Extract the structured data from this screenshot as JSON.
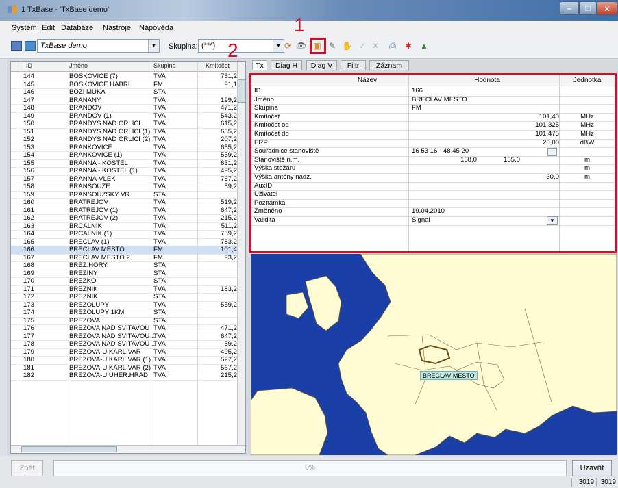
{
  "window": {
    "title": "1 TxBase - 'TxBase demo'",
    "min": "–",
    "max": "□",
    "close": "x"
  },
  "menu": [
    "Systém",
    "Edit",
    "Databáze",
    "Nástroje",
    "Nápověda"
  ],
  "toolbar": {
    "database": "TxBase demo",
    "skupina_label": "Skupina:",
    "skupina_value": "(***)"
  },
  "annotations": {
    "a1": "1",
    "a2": "2"
  },
  "grid": {
    "headers": [
      "ID",
      "Jméno",
      "Skupina",
      "Kmitočet"
    ],
    "rows": [
      [
        "144",
        "BOSKOVICE (7)",
        "TVA",
        "751,2"
      ],
      [
        "145",
        "BOSKOVICE HABRI",
        "FM",
        "91,1"
      ],
      [
        "146",
        "BOZI MUKA",
        "STA",
        ""
      ],
      [
        "147",
        "BRANANY",
        "TVA",
        "199,2"
      ],
      [
        "148",
        "BRANDOV",
        "TVA",
        "471,2"
      ],
      [
        "149",
        "BRANDOV (1)",
        "TVA",
        "543,2"
      ],
      [
        "150",
        "BRANDYS NAD ORLICI",
        "TVA",
        "615,2"
      ],
      [
        "151",
        "BRANDYS NAD ORLICI (1)",
        "TVA",
        "655,2"
      ],
      [
        "152",
        "BRANDYS NAD ORLICI (2)",
        "TVA",
        "207,2"
      ],
      [
        "153",
        "BRANKOVICE",
        "TVA",
        "655,2"
      ],
      [
        "154",
        "BRANKOVICE (1)",
        "TVA",
        "559,2"
      ],
      [
        "155",
        "BRANNA - KOSTEL",
        "TVA",
        "631,2"
      ],
      [
        "156",
        "BRANNA - KOSTEL (1)",
        "TVA",
        "495,2"
      ],
      [
        "157",
        "BRANNA-VLEK",
        "TVA",
        "767,2"
      ],
      [
        "158",
        "BRANSOUZE",
        "TVA",
        "59,2"
      ],
      [
        "159",
        "BRANSOUZSKY VR",
        "STA",
        ""
      ],
      [
        "160",
        "BRATREJOV",
        "TVA",
        "519,2"
      ],
      [
        "161",
        "BRATREJOV (1)",
        "TVA",
        "647,2"
      ],
      [
        "162",
        "BRATREJOV (2)",
        "TVA",
        "215,2"
      ],
      [
        "163",
        "BRCALNIK",
        "TVA",
        "511,2"
      ],
      [
        "164",
        "BRCALNIK (1)",
        "TVA",
        "759,2"
      ],
      [
        "165",
        "BRECLAV (1)",
        "TVA",
        "783,2"
      ],
      [
        "166",
        "BRECLAV MESTO",
        "FM",
        "101,4"
      ],
      [
        "167",
        "BRECLAV MESTO 2",
        "FM",
        "93,2"
      ],
      [
        "168",
        "BREZ.HORY",
        "STA",
        ""
      ],
      [
        "169",
        "BREZINY",
        "STA",
        ""
      ],
      [
        "170",
        "BREZKO",
        "STA",
        ""
      ],
      [
        "171",
        "BREZNIK",
        "TVA",
        "183,2"
      ],
      [
        "172",
        "BREZNIK",
        "STA",
        ""
      ],
      [
        "173",
        "BREZOLUPY",
        "TVA",
        "559,2"
      ],
      [
        "174",
        "BREZOLUPY 1KM",
        "STA",
        ""
      ],
      [
        "175",
        "BREZOVA",
        "STA",
        ""
      ],
      [
        "176",
        "BREZOVA NAD SVITAVOU",
        "TVA",
        "471,2"
      ],
      [
        "177",
        "BREZOVA NAD SVITAVOU ...",
        "TVA",
        "647,2"
      ],
      [
        "178",
        "BREZOVA NAD SVITAVOU ...",
        "TVA",
        "59,2"
      ],
      [
        "179",
        "BREZOVA-U KARL.VAR",
        "TVA",
        "495,2"
      ],
      [
        "180",
        "BREZOVA-U KARL.VAR (1)",
        "TVA",
        "527,2"
      ],
      [
        "181",
        "BREZOVA-U KARL.VAR (2)",
        "TVA",
        "567,2"
      ],
      [
        "182",
        "BREZOVA-U UHER.HRAD",
        "TVA",
        "215,2"
      ]
    ],
    "selected_id": "166"
  },
  "tabs": [
    "Tx",
    "Diag H",
    "Diag V",
    "Filtr",
    "Záznam"
  ],
  "props": {
    "headers": [
      "Název",
      "Hodnota",
      "Jednotka"
    ],
    "rows": [
      {
        "name": "ID",
        "value": "166",
        "unit": "",
        "align": "left"
      },
      {
        "name": "Jméno",
        "value": "BRECLAV MESTO",
        "unit": "",
        "align": "left"
      },
      {
        "name": "Skupina",
        "value": "FM",
        "unit": "",
        "align": "left"
      },
      {
        "name": "Kmitočet",
        "value": "101,40",
        "unit": "MHz",
        "align": "right"
      },
      {
        "name": "Kmitočet od",
        "value": "101,325",
        "unit": "MHz",
        "align": "right"
      },
      {
        "name": "Kmitočet do",
        "value": "101,475",
        "unit": "MHz",
        "align": "right"
      },
      {
        "name": "ERP",
        "value": "20,00",
        "unit": "dBW",
        "align": "right"
      },
      {
        "name": "Souřadnice stanoviště",
        "value": "16 53 16 - 48 45 20",
        "unit": "",
        "align": "left"
      },
      {
        "name": "Stanoviště n.m.",
        "value": "158,0",
        "value2": "155,0",
        "unit": "m",
        "align": "split"
      },
      {
        "name": "Výška stožáru",
        "value": "",
        "unit": "m",
        "align": "right"
      },
      {
        "name": "Výška antény nadz.",
        "value": "30,0",
        "unit": "m",
        "align": "right"
      },
      {
        "name": "AuxID",
        "value": "",
        "unit": "",
        "align": "left"
      },
      {
        "name": "Uživatel",
        "value": "",
        "unit": "",
        "align": "left"
      },
      {
        "name": "Poznámka",
        "value": "",
        "unit": "",
        "align": "left"
      },
      {
        "name": "Změněno",
        "value": "19.04.2010",
        "unit": "",
        "align": "left"
      },
      {
        "name": "Validita",
        "value": "Signal",
        "unit": "",
        "align": "left"
      }
    ]
  },
  "map": {
    "label": "BRECLAV MESTO",
    "land": "#fffbd5",
    "sea": "#1a3fa8"
  },
  "status": {
    "back": "Zpět",
    "progress": "0%",
    "progress_value": 0,
    "close": "Uzavřít",
    "count1": "3019",
    "count2": "3019"
  }
}
